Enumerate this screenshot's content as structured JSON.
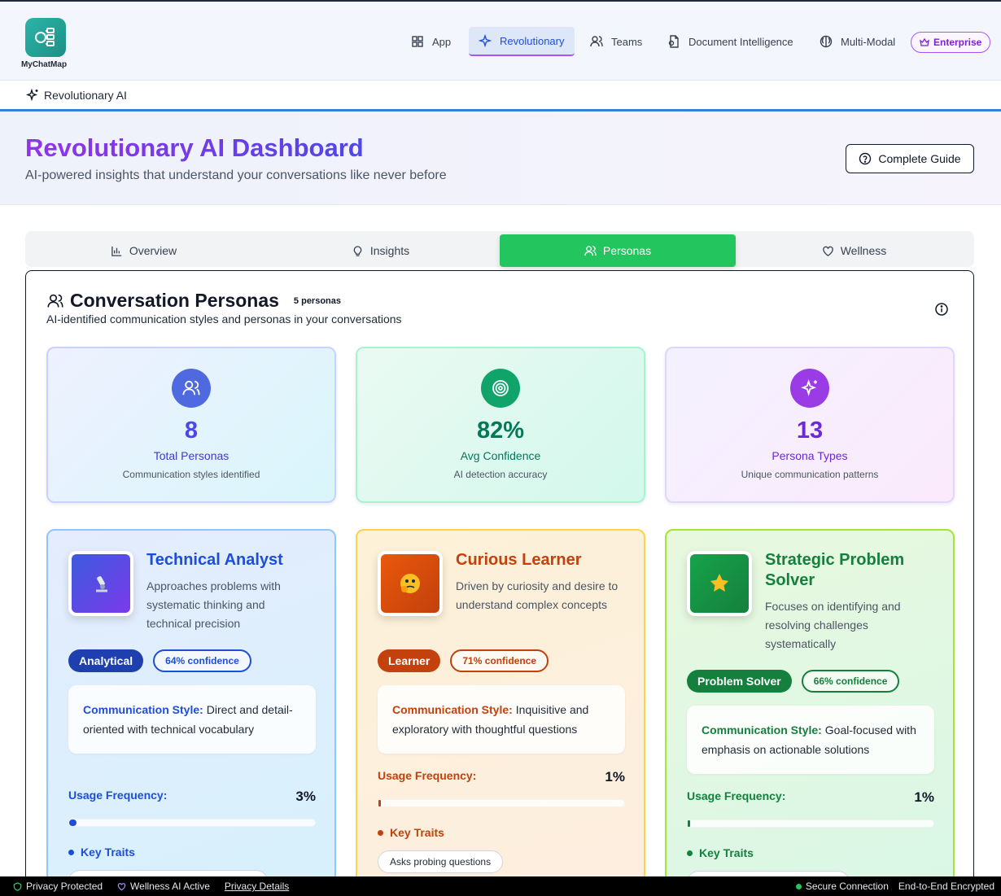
{
  "brand": {
    "name": "MyChatMap"
  },
  "nav": {
    "items": [
      {
        "label": "App",
        "icon": "grid-icon"
      },
      {
        "label": "Revolutionary",
        "icon": "sparkles-icon"
      },
      {
        "label": "Teams",
        "icon": "users-icon"
      },
      {
        "label": "Document Intelligence",
        "icon": "document-icon"
      },
      {
        "label": "Multi-Modal",
        "icon": "brain-icon"
      }
    ],
    "enterprise_label": "Enterprise"
  },
  "breadcrumb": {
    "label": "Revolutionary AI"
  },
  "hero": {
    "title": "Revolutionary AI Dashboard",
    "subtitle": "AI-powered insights that understand your conversations like never before",
    "guide_label": "Complete Guide"
  },
  "tabs": [
    {
      "label": "Overview",
      "icon": "bar-chart-icon"
    },
    {
      "label": "Insights",
      "icon": "lightbulb-icon"
    },
    {
      "label": "Personas",
      "icon": "users-icon"
    },
    {
      "label": "Wellness",
      "icon": "heart-icon"
    }
  ],
  "panel": {
    "title": "Conversation Personas",
    "count": "5 personas",
    "subtitle": "AI-identified communication styles and personas in your conversations"
  },
  "stats": [
    {
      "value": "8",
      "label": "Total Personas",
      "desc": "Communication styles identified",
      "color": "#4f46e5"
    },
    {
      "value": "82%",
      "label": "Avg Confidence",
      "desc": "AI detection accuracy",
      "color": "#059669"
    },
    {
      "value": "13",
      "label": "Persona Types",
      "desc": "Unique communication patterns",
      "color": "#7c3aed"
    }
  ],
  "personas": [
    {
      "title": "Technical Analyst",
      "desc": "Approaches problems with systematic thinking and technical precision",
      "badge": "Analytical",
      "confidence": "64% confidence",
      "style_label": "Communication Style:",
      "style": "Direct and detail-oriented with technical vocabulary",
      "usage_label": "Usage Frequency:",
      "usage_pct": "3%",
      "usage_value": 0.03,
      "traits_label": "Key Traits",
      "accent": "#1d4ed8"
    },
    {
      "title": "Curious Learner",
      "desc": "Driven by curiosity and desire to understand complex concepts",
      "badge": "Learner",
      "confidence": "71% confidence",
      "style_label": "Communication Style:",
      "style": "Inquisitive and exploratory with thoughtful questions",
      "usage_label": "Usage Frequency:",
      "usage_pct": "1%",
      "usage_value": 0.01,
      "traits_label": "Key Traits",
      "trait_chip": "Asks probing questions",
      "accent": "#c2410c"
    },
    {
      "title": "Strategic Problem Solver",
      "desc": "Focuses on identifying and resolving challenges systematically",
      "badge": "Problem Solver",
      "confidence": "66% confidence",
      "style_label": "Communication Style:",
      "style": "Goal-focused with emphasis on actionable solutions",
      "usage_label": "Usage Frequency:",
      "usage_pct": "1%",
      "usage_value": 0.01,
      "traits_label": "Key Traits",
      "accent": "#15803d"
    }
  ],
  "footer": {
    "privacy": "Privacy Protected",
    "wellness": "Wellness AI Active",
    "details": "Privacy Details",
    "secure": "Secure Connection",
    "encrypted": "End-to-End Encrypted"
  }
}
